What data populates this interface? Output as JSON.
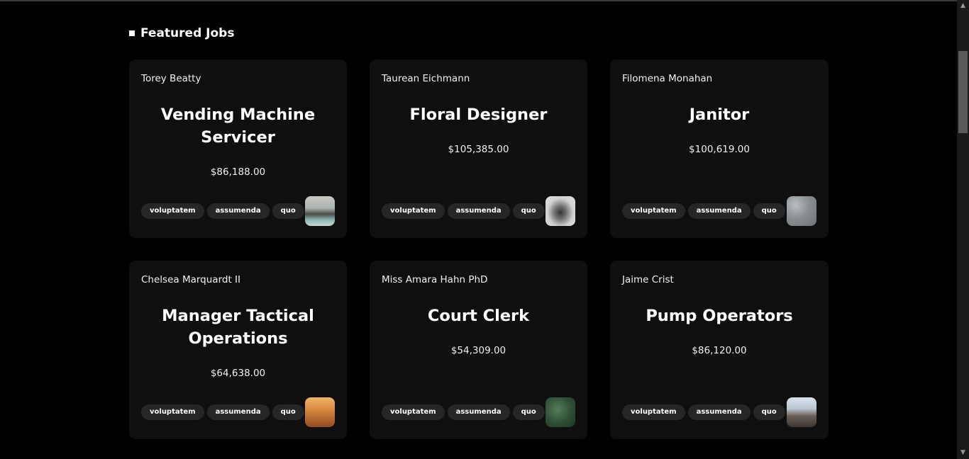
{
  "section": {
    "title": "Featured Jobs"
  },
  "jobs": [
    {
      "company": "Torey Beatty",
      "title": "Vending Machine Servicer",
      "salary": "$86,188.00",
      "tags": [
        "voluptatem",
        "assumenda",
        "quo"
      ],
      "image": "beach-photo"
    },
    {
      "company": "Taurean Eichmann",
      "title": "Floral Designer",
      "salary": "$105,385.00",
      "tags": [
        "voluptatem",
        "assumenda",
        "quo"
      ],
      "image": "statue-photo"
    },
    {
      "company": "Filomena Monahan",
      "title": "Janitor",
      "salary": "$100,619.00",
      "tags": [
        "voluptatem",
        "assumenda",
        "quo"
      ],
      "image": "rock-photo"
    },
    {
      "company": "Chelsea Marquardt II",
      "title": "Manager Tactical Operations",
      "salary": "$64,638.00",
      "tags": [
        "voluptatem",
        "assumenda",
        "quo"
      ],
      "image": "sunset-city-photo"
    },
    {
      "company": "Miss Amara Hahn PhD",
      "title": "Court Clerk",
      "salary": "$54,309.00",
      "tags": [
        "voluptatem",
        "assumenda",
        "quo"
      ],
      "image": "forest-photo"
    },
    {
      "company": "Jaime Crist",
      "title": "Pump Operators",
      "salary": "$86,120.00",
      "tags": [
        "voluptatem",
        "assumenda",
        "quo"
      ],
      "image": "city-skyline-photo"
    }
  ],
  "scrollbar": {
    "up_icon": "triangle-up-icon",
    "down_icon": "triangle-down-icon"
  }
}
